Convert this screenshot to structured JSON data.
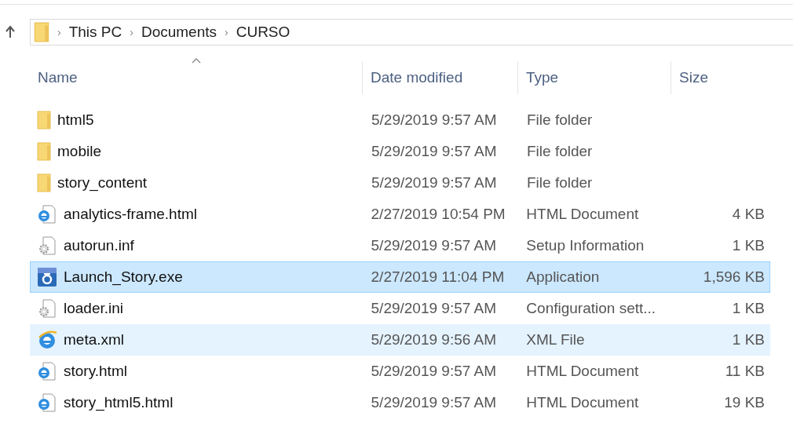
{
  "address_bar": {
    "path": [
      "This PC",
      "Documents",
      "CURSO"
    ],
    "separator": "›"
  },
  "table": {
    "columns": [
      {
        "label": "Name",
        "sorted": true
      },
      {
        "label": "Date modified",
        "sorted": false
      },
      {
        "label": "Type",
        "sorted": false
      },
      {
        "label": "Size",
        "sorted": false
      }
    ],
    "rows": [
      {
        "kind": "folder",
        "name": "html5",
        "date": "5/29/2019 9:57 AM",
        "type": "File folder",
        "size": "",
        "selected": false,
        "hovered": false
      },
      {
        "kind": "folder",
        "name": "mobile",
        "date": "5/29/2019 9:57 AM",
        "type": "File folder",
        "size": "",
        "selected": false,
        "hovered": false
      },
      {
        "kind": "folder",
        "name": "story_content",
        "date": "5/29/2019 9:57 AM",
        "type": "File folder",
        "size": "",
        "selected": false,
        "hovered": false
      },
      {
        "kind": "webpage",
        "name": "analytics-frame.html",
        "date": "2/27/2019 10:54 PM",
        "type": "HTML Document",
        "size": "4 KB",
        "selected": false,
        "hovered": false
      },
      {
        "kind": "setup",
        "name": "autorun.inf",
        "date": "5/29/2019 9:57 AM",
        "type": "Setup Information",
        "size": "1 KB",
        "selected": false,
        "hovered": false
      },
      {
        "kind": "application",
        "name": "Launch_Story.exe",
        "date": "2/27/2019 11:04 PM",
        "type": "Application",
        "size": "1,596 KB",
        "selected": true,
        "hovered": false
      },
      {
        "kind": "setup",
        "name": "loader.ini",
        "date": "5/29/2019 9:57 AM",
        "type": "Configuration sett...",
        "size": "1 KB",
        "selected": false,
        "hovered": false
      },
      {
        "kind": "xml",
        "name": "meta.xml",
        "date": "5/29/2019 9:56 AM",
        "type": "XML File",
        "size": "1 KB",
        "selected": false,
        "hovered": true
      },
      {
        "kind": "webpage",
        "name": "story.html",
        "date": "5/29/2019 9:57 AM",
        "type": "HTML Document",
        "size": "11 KB",
        "selected": false,
        "hovered": false
      },
      {
        "kind": "webpage",
        "name": "story_html5.html",
        "date": "5/29/2019 9:57 AM",
        "type": "HTML Document",
        "size": "19 KB",
        "selected": false,
        "hovered": false
      }
    ]
  }
}
